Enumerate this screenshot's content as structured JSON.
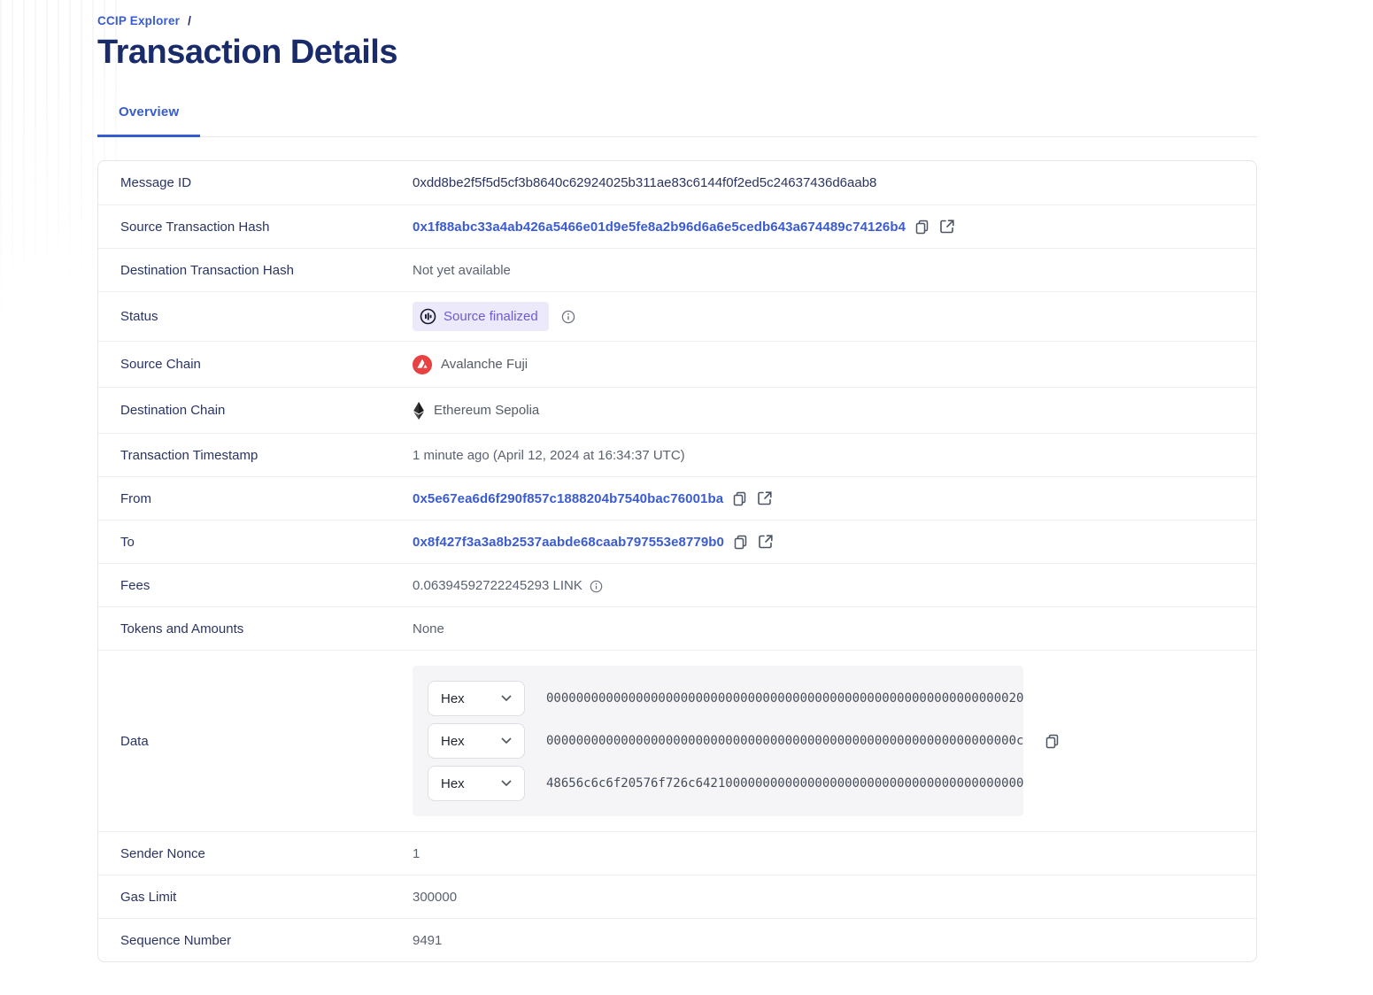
{
  "breadcrumb": {
    "link_label": "CCIP Explorer",
    "separator": "/"
  },
  "page": {
    "title": "Transaction Details"
  },
  "tabs": {
    "overview": "Overview"
  },
  "rows": {
    "message_id": {
      "label": "Message ID",
      "value": "0xdd8be2f5f5d5cf3b8640c62924025b311ae83c6144f0f2ed5c24637436d6aab8"
    },
    "source_tx_hash": {
      "label": "Source Transaction Hash",
      "value": "0x1f88abc33a4ab426a5466e01d9e5fe8a2b96d6a6e5cedb643a674489c74126b4"
    },
    "dest_tx_hash": {
      "label": "Destination Transaction Hash",
      "value": "Not yet available"
    },
    "status": {
      "label": "Status",
      "badge": "Source finalized"
    },
    "source_chain": {
      "label": "Source Chain",
      "value": "Avalanche Fuji"
    },
    "dest_chain": {
      "label": "Destination Chain",
      "value": "Ethereum Sepolia"
    },
    "timestamp": {
      "label": "Transaction Timestamp",
      "value": "1 minute ago (April 12, 2024 at 16:34:37 UTC)"
    },
    "from": {
      "label": "From",
      "value": "0x5e67ea6d6f290f857c1888204b7540bac76001ba"
    },
    "to": {
      "label": "To",
      "value": "0x8f427f3a3a8b2537aabde68caab797553e8779b0"
    },
    "fees": {
      "label": "Fees",
      "value": "0.06394592722245293 LINK"
    },
    "tokens": {
      "label": "Tokens and Amounts",
      "value": "None"
    },
    "data": {
      "label": "Data",
      "encoding": "Hex",
      "lines": [
        "0000000000000000000000000000000000000000000000000000000000000020",
        "000000000000000000000000000000000000000000000000000000000000000c",
        "48656c6c6f20576f726c64210000000000000000000000000000000000000000"
      ]
    },
    "sender_nonce": {
      "label": "Sender Nonce",
      "value": "1"
    },
    "gas_limit": {
      "label": "Gas Limit",
      "value": "300000"
    },
    "sequence_number": {
      "label": "Sequence Number",
      "value": "9491"
    }
  },
  "icons": {
    "copy": "copy-icon",
    "external_link": "external-link-icon",
    "info": "info-icon",
    "chevron_down": "chevron-down-icon",
    "avalanche": "avalanche-icon",
    "ethereum": "ethereum-icon",
    "status_progress": "status-progress-icon"
  },
  "colors": {
    "accent_blue": "#375BD2",
    "heading_navy": "#1A2B6B",
    "link_blue": "#3A5BD2",
    "badge_bg": "#ECE9FA",
    "badge_text": "#6D5BD0",
    "avalanche_red": "#E84142",
    "value_gray": "#5A6170",
    "data_box_bg": "#F5F5F7"
  }
}
